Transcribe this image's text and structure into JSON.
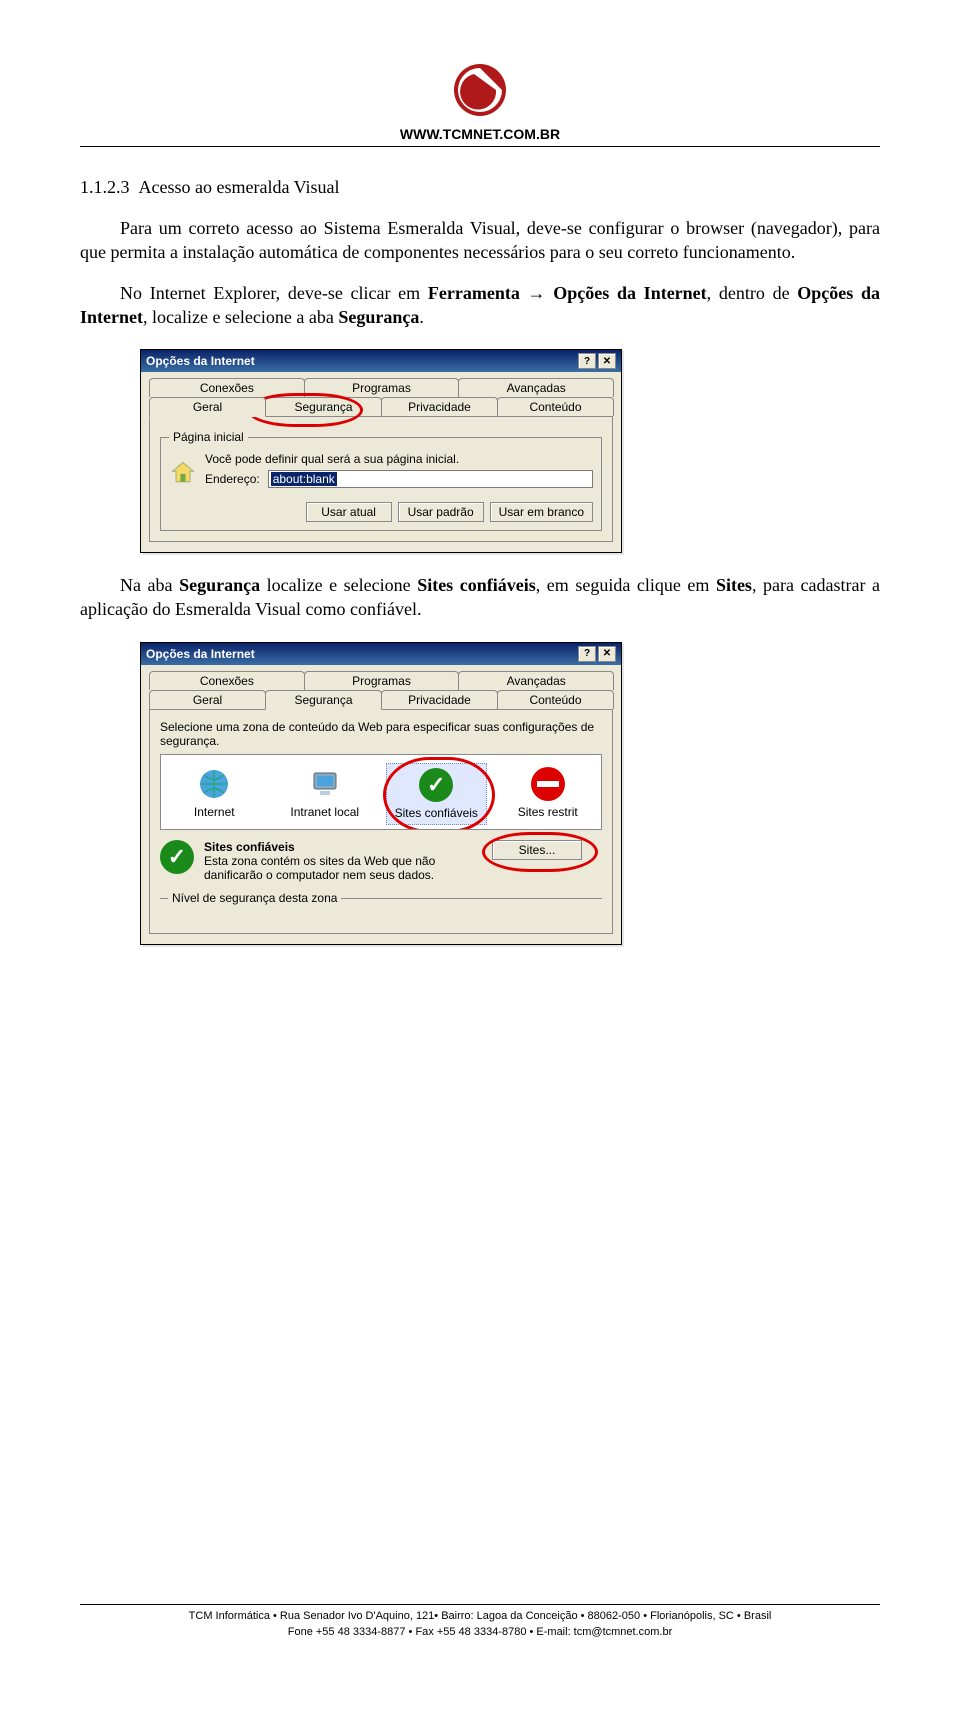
{
  "header": {
    "site_url": "WWW.TCMNET.COM.BR"
  },
  "section": {
    "number": "1.1.2.3",
    "title": "Acesso ao esmeralda Visual",
    "para1_part1": "Para um correto acesso ao Sistema Esmeralda Visual, deve-se configurar o browser (navegador), para que permita a instalação automática de componentes necessários para o seu correto funcionamento.",
    "para2_pre": "No Internet Explorer, deve-se clicar em ",
    "para2_bold1": "Ferramenta",
    "para2_arrow": " → ",
    "para2_bold2": "Opções da Internet",
    "para2_mid": ", dentro de ",
    "para2_bold3": "Opções da Internet",
    "para2_post": ", localize e selecione a aba ",
    "para2_bold4": "Segurança",
    "para2_end": ".",
    "para3_pre": "Na aba ",
    "para3_b1": "Segurança",
    "para3_mid1": " localize e selecione ",
    "para3_b2": "Sites confiáveis",
    "para3_mid2": ", em seguida clique em ",
    "para3_b3": "Sites",
    "para3_post": ", para cadastrar a aplicação do Esmeralda Visual como confiável."
  },
  "dialog1": {
    "title": "Opções da Internet",
    "tabs_row1": [
      "Conexões",
      "Programas",
      "Avançadas"
    ],
    "tabs_row2": [
      "Geral",
      "Segurança",
      "Privacidade",
      "Conteúdo"
    ],
    "fieldset_label": "Página inicial",
    "homepage_hint": "Você pode definir qual será a sua página inicial.",
    "address_label": "Endereço:",
    "address_value": "about:blank",
    "btn_current": "Usar atual",
    "btn_default": "Usar padrão",
    "btn_blank": "Usar em branco"
  },
  "dialog2": {
    "title": "Opções da Internet",
    "tabs_row1": [
      "Conexões",
      "Programas",
      "Avançadas"
    ],
    "tabs_row2": [
      "Geral",
      "Segurança",
      "Privacidade",
      "Conteúdo"
    ],
    "zone_instruction": "Selecione uma zona de conteúdo da Web para especificar suas configurações de segurança.",
    "zones": [
      "Internet",
      "Intranet local",
      "Sites confiáveis",
      "Sites restrit"
    ],
    "selected_zone_title": "Sites confiáveis",
    "selected_zone_desc": "Esta zona contém os sites da Web que não danificarão o computador nem seus dados.",
    "sites_button": "Sites...",
    "level_fieldset": "Nível de segurança desta zona"
  },
  "footer": {
    "line1": "TCM Informática • Rua Senador Ivo D'Aquino, 121• Bairro: Lagoa da Conceição • 88062-050 • Florianópolis, SC • Brasil",
    "line2": "Fone +55 48 3334-8877 • Fax +55 48 3334-8780 • E-mail: tcm@tcmnet.com.br"
  }
}
